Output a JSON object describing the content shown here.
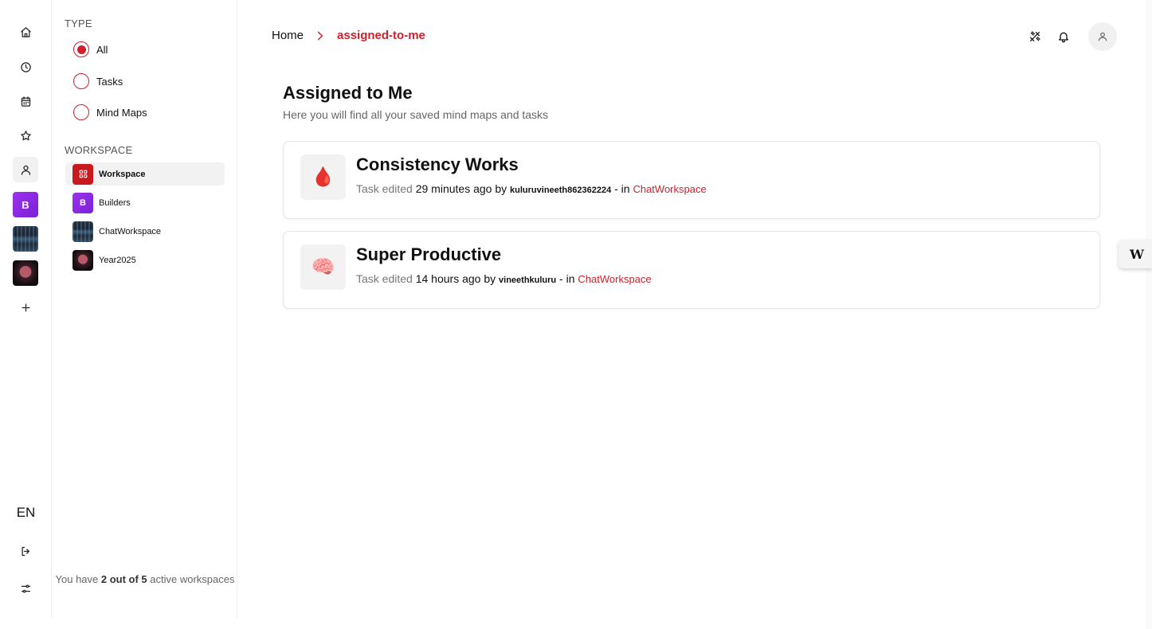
{
  "rail": {
    "workspace_initial": "B",
    "language": "EN"
  },
  "sidebar": {
    "type_title": "TYPE",
    "type_options": [
      {
        "label": "All",
        "checked": true
      },
      {
        "label": "Tasks",
        "checked": false
      },
      {
        "label": "Mind Maps",
        "checked": false
      }
    ],
    "workspace_title": "WORKSPACE",
    "workspaces": [
      {
        "label": "Workspace",
        "active": true,
        "icon": "grid-icon"
      },
      {
        "label": "Builders",
        "initial": "B"
      },
      {
        "label": "ChatWorkspace"
      },
      {
        "label": "Year2025"
      }
    ],
    "footer": {
      "prefix": "You have ",
      "count": "2 out of 5",
      "suffix": " active workspaces"
    }
  },
  "header": {
    "breadcrumb_home": "Home",
    "breadcrumb_current": "assigned-to-me"
  },
  "main": {
    "title": "Assigned to Me",
    "subtitle": "Here you will find all your saved mind maps and tasks",
    "cards": [
      {
        "icon": "🩸",
        "title": "Consistency Works",
        "action": "Task edited",
        "time": "29 minutes ago",
        "by": "by",
        "user": "kuluruvineeth862362224",
        "in": "- in",
        "workspace": "ChatWorkspace"
      },
      {
        "icon": "🧠",
        "title": "Super Productive",
        "action": "Task edited",
        "time": "14 hours ago",
        "by": "by",
        "user": "vineethkuluru",
        "in": "- in",
        "workspace": "ChatWorkspace"
      }
    ]
  },
  "edge_widget": {
    "label": "W"
  },
  "colors": {
    "accent": "#d11f2b",
    "workspace_purple": "#8e2de2"
  }
}
